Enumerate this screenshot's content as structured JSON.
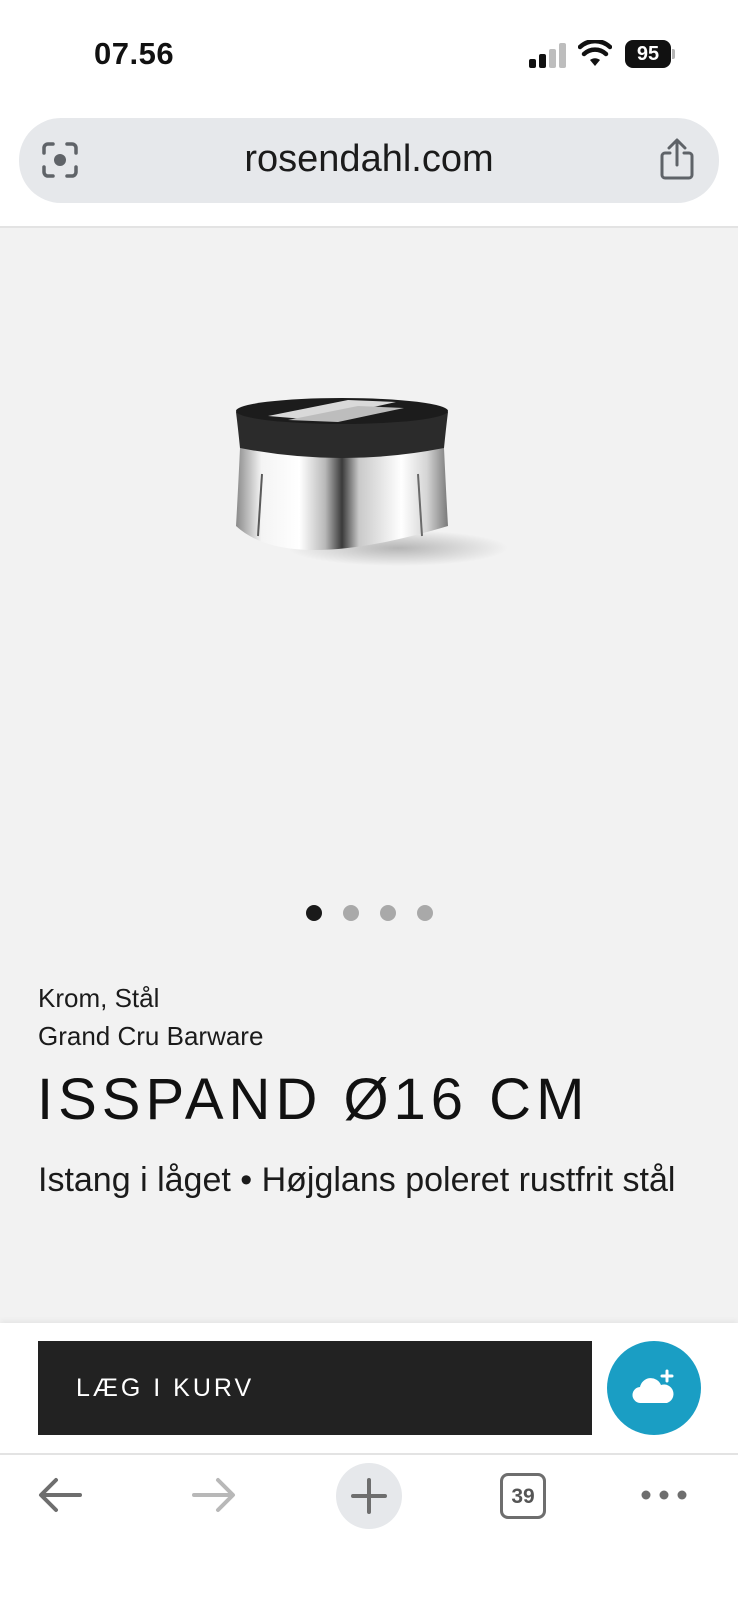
{
  "status_bar": {
    "time": "07.56",
    "battery": "95"
  },
  "browser": {
    "url": "rosendahl.com",
    "tab_count": "39"
  },
  "product": {
    "image_count": 4,
    "active_image": 0,
    "material": "Krom, Stål",
    "collection": "Grand Cru Barware",
    "title": "ISSPAND Ø16 CM",
    "features": "Istang i låget • Højglans poleret rustfrit stål"
  },
  "cart": {
    "add_label": "LÆG I KURV"
  },
  "colors": {
    "page_bg": "#f2f2f2",
    "button_dark": "#222222",
    "accent": "#1a9ec4"
  },
  "icons": [
    "lens-icon",
    "share-icon",
    "cloud-plus-icon",
    "back-arrow-icon",
    "forward-arrow-icon",
    "plus-icon",
    "more-icon"
  ]
}
